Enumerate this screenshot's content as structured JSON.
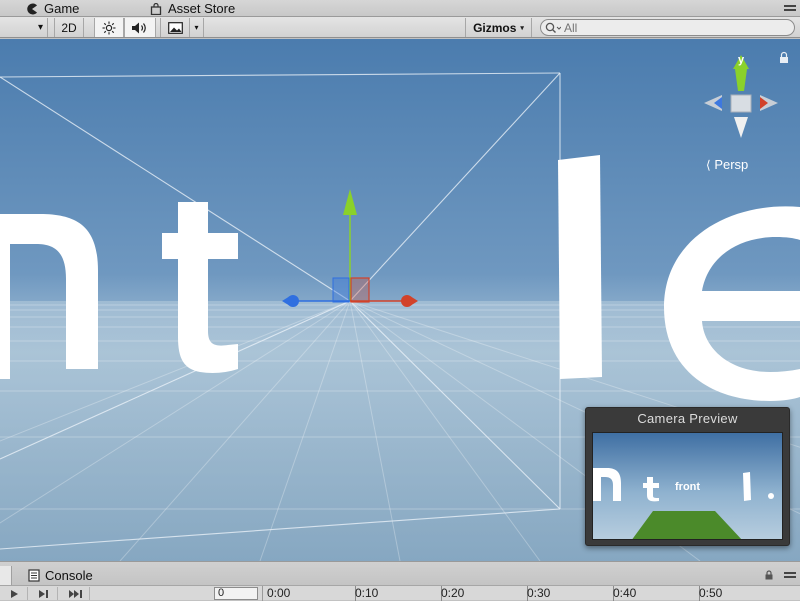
{
  "tabs": {
    "game_label": "Game",
    "store_label": "Asset Store"
  },
  "toolbar": {
    "draw_mode_caret": "▾",
    "mode_2d_label": "2D",
    "gizmos_label": "Gizmos",
    "gizmos_caret": "▾",
    "search_placeholder": "All"
  },
  "scene": {
    "persp_label": "Persp",
    "gizmo_axis_label": "y",
    "gizmo_colors": {
      "y_axis": "#8ad12a",
      "x_axis": "#d2422a",
      "z_axis": "#2f6fe0"
    }
  },
  "camera_preview": {
    "title": "Camera Preview",
    "preview_text": "front",
    "ground_color": "#4b8a2a"
  },
  "console": {
    "tab_label": "Console"
  },
  "timeline": {
    "frame_value": "0",
    "ticks": [
      "0:00",
      "0:10",
      "0:20",
      "0:30",
      "0:40",
      "0:50"
    ]
  },
  "colors": {
    "sky_top": "#4f7fae",
    "sky_horizon": "#a6c2d8",
    "ground": "#8fa6b6"
  }
}
